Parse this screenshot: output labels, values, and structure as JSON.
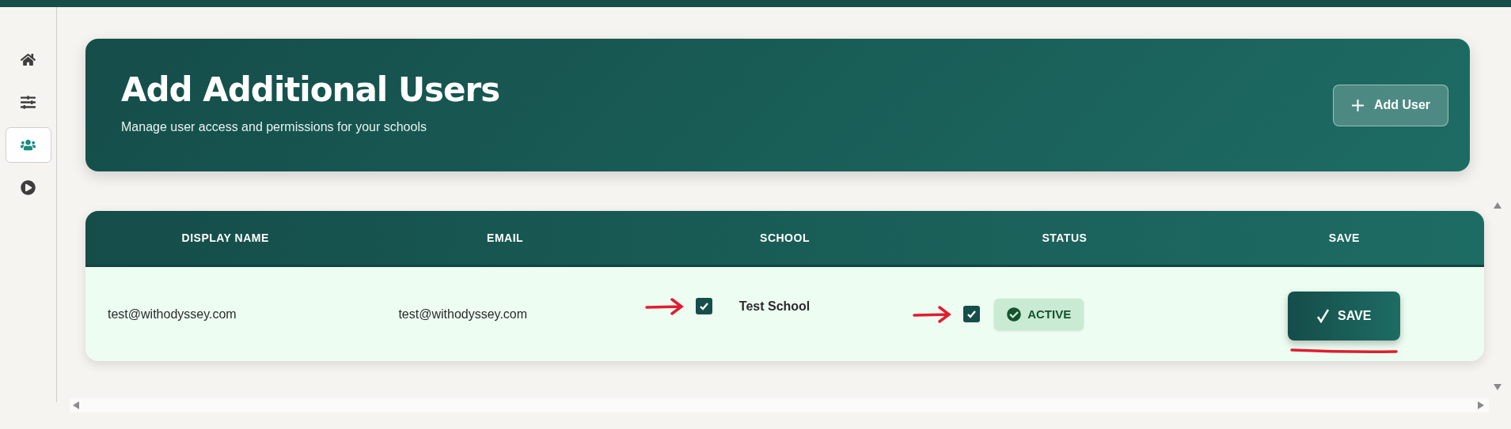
{
  "sidebar": {
    "items": [
      {
        "kind": "home",
        "selected": false
      },
      {
        "kind": "sliders",
        "selected": false
      },
      {
        "kind": "users",
        "selected": true
      },
      {
        "kind": "play",
        "selected": false
      }
    ]
  },
  "header": {
    "title": "Add Additional Users",
    "subtitle": "Manage user access and permissions for your schools",
    "add_button": "Add User"
  },
  "table": {
    "columns": [
      "DISPLAY NAME",
      "EMAIL",
      "SCHOOL",
      "STATUS",
      "SAVE"
    ],
    "rows": [
      {
        "display_name": "test@withodyssey.com",
        "email": "test@withodyssey.com",
        "school": {
          "name": "Test School",
          "checked": true
        },
        "status": {
          "checked": true,
          "label": "ACTIVE"
        },
        "save": "SAVE"
      }
    ]
  }
}
